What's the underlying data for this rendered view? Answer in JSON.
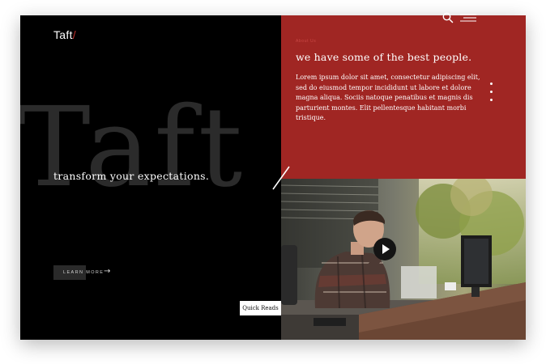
{
  "header": {
    "logo_text": "Taft",
    "logo_slash": "/",
    "search_icon": "search-icon",
    "menu_icon": "hamburger-menu-icon"
  },
  "hero": {
    "background_word": "Taft",
    "tagline": "transform your expectations.",
    "cta_label": "LEARN MORE",
    "cta_arrow": "→"
  },
  "feature": {
    "eyebrow": "About Us",
    "heading": "we have some of the best people.",
    "body": "Lorem ipsum dolor sit amet, consectetur adipiscing elit, sed do eiusmod tempor incididunt ut labore et dolore magna aliqua. Sociis natoque penatibus et magnis dis parturient montes. Elit pellentesque habitant morbi tristique."
  },
  "side_nav": {
    "icon": "vertical-dots-icon",
    "count": 3
  },
  "media": {
    "play_icon": "play-icon",
    "photo_description_icon": "office-photo"
  },
  "footer": {
    "quick_reads_label": "Quick Reads"
  },
  "colors": {
    "left_panel": "#000000",
    "accent_red": "#a02623",
    "big_word": "#2b2b2b",
    "text_light": "#ffffff"
  }
}
